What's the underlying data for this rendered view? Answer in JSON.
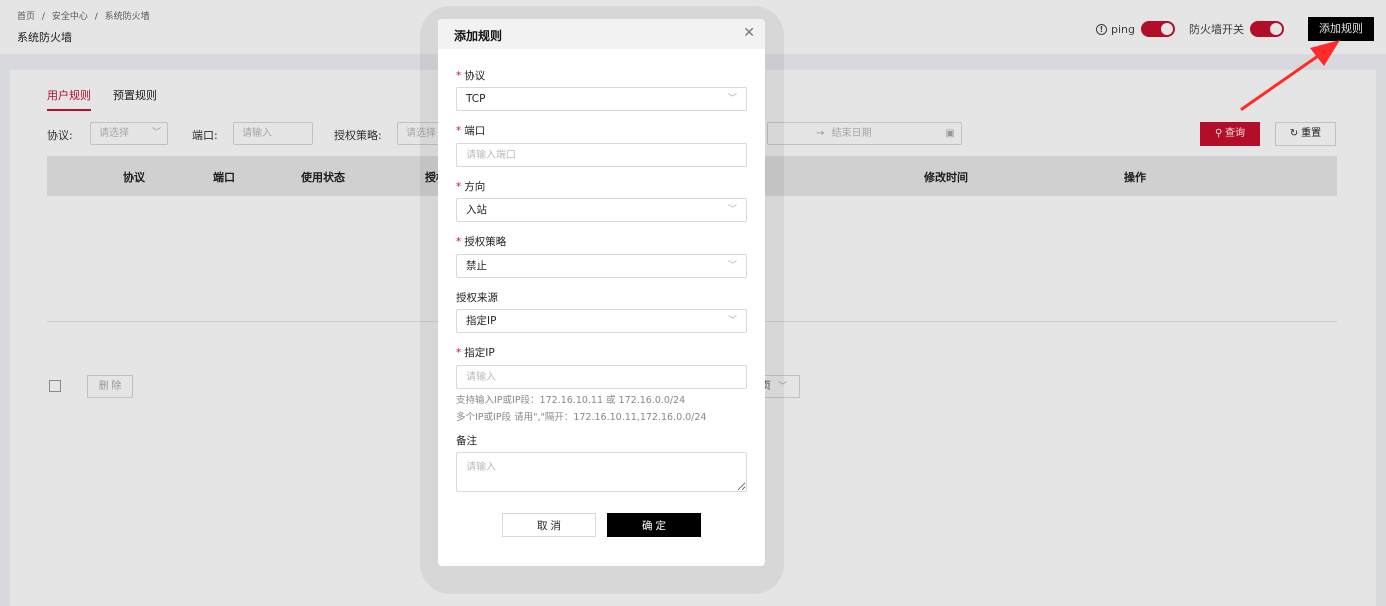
{
  "breadcrumb": [
    "首页",
    "/",
    "安全中心",
    "/",
    "系统防火墙"
  ],
  "page_title": "系统防火墙",
  "top_controls": {
    "ping_label": "ping",
    "firewall_label": "防火墙开关",
    "add_rule": "添加规则"
  },
  "tabs": [
    {
      "label": "用户规则",
      "active": true
    },
    {
      "label": "预置规则",
      "active": false
    }
  ],
  "filters": {
    "protocol_label": "协议:",
    "protocol_placeholder": "请选择",
    "port_label": "端口:",
    "port_placeholder": "请输入",
    "policy_label": "授权策略:",
    "policy_placeholder": "请选择",
    "end_date_placeholder": "结束日期",
    "date_arrow": "→",
    "query": "查询",
    "reset": "重置"
  },
  "table": {
    "columns": [
      "协议",
      "端口",
      "使用状态",
      "授权",
      "修改时间",
      "操作"
    ]
  },
  "bottom": {
    "delete": "删 除",
    "pager_fragment": "页"
  },
  "modal": {
    "title": "添加规则",
    "protocol_label": "协议",
    "protocol_value": "TCP",
    "port_label": "端口",
    "port_placeholder": "请输入端口",
    "direction_label": "方向",
    "direction_value": "入站",
    "policy_label": "授权策略",
    "policy_value": "禁止",
    "source_label": "授权来源",
    "source_value": "指定IP",
    "ip_label": "指定IP",
    "ip_placeholder": "请输入",
    "hint1": "支持输入IP或IP段：172.16.10.11 或 172.16.0.0/24",
    "hint2": "多个IP或IP段 请用\",\"隔开：172.16.10.11,172.16.0.0/24",
    "remark_label": "备注",
    "remark_placeholder": "请输入",
    "cancel": "取 消",
    "confirm": "确 定"
  },
  "colors": {
    "accent": "#c8102e",
    "primary_button": "#000000",
    "arrow": "#ff2a2a"
  },
  "icons": [
    "info-icon",
    "close-icon",
    "chevron-down-icon",
    "search-icon",
    "refresh-icon",
    "calendar-icon",
    "arrow-annotation-icon"
  ]
}
